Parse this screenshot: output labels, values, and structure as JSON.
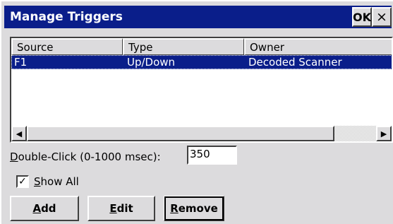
{
  "window": {
    "title": "Manage Triggers",
    "ok_label": "OK",
    "close_label": "×"
  },
  "list": {
    "columns": [
      "Source",
      "Type",
      "Owner"
    ],
    "rows": [
      {
        "source": "F1",
        "type": "Up/Down",
        "owner": "Decoded Scanner",
        "selected": true
      }
    ],
    "scrollbar": {
      "left_arrow": "◀",
      "right_arrow": "▶"
    }
  },
  "double_click": {
    "label_prefix": "",
    "label_accel": "D",
    "label_rest": "ouble-Click (0-1000 msec):",
    "value": "350"
  },
  "show_all": {
    "checked": true,
    "check_glyph": "✓",
    "label_accel": "S",
    "label_rest": "how All"
  },
  "buttons": {
    "add": {
      "accel": "A",
      "rest": "dd"
    },
    "edit": {
      "accel": "E",
      "rest": "dit"
    },
    "remove": {
      "accel": "R",
      "rest": "emove"
    }
  },
  "colors": {
    "titlebar": "#0a1e8a",
    "selection": "#0a1e8a",
    "face": "#dcdbdd"
  }
}
